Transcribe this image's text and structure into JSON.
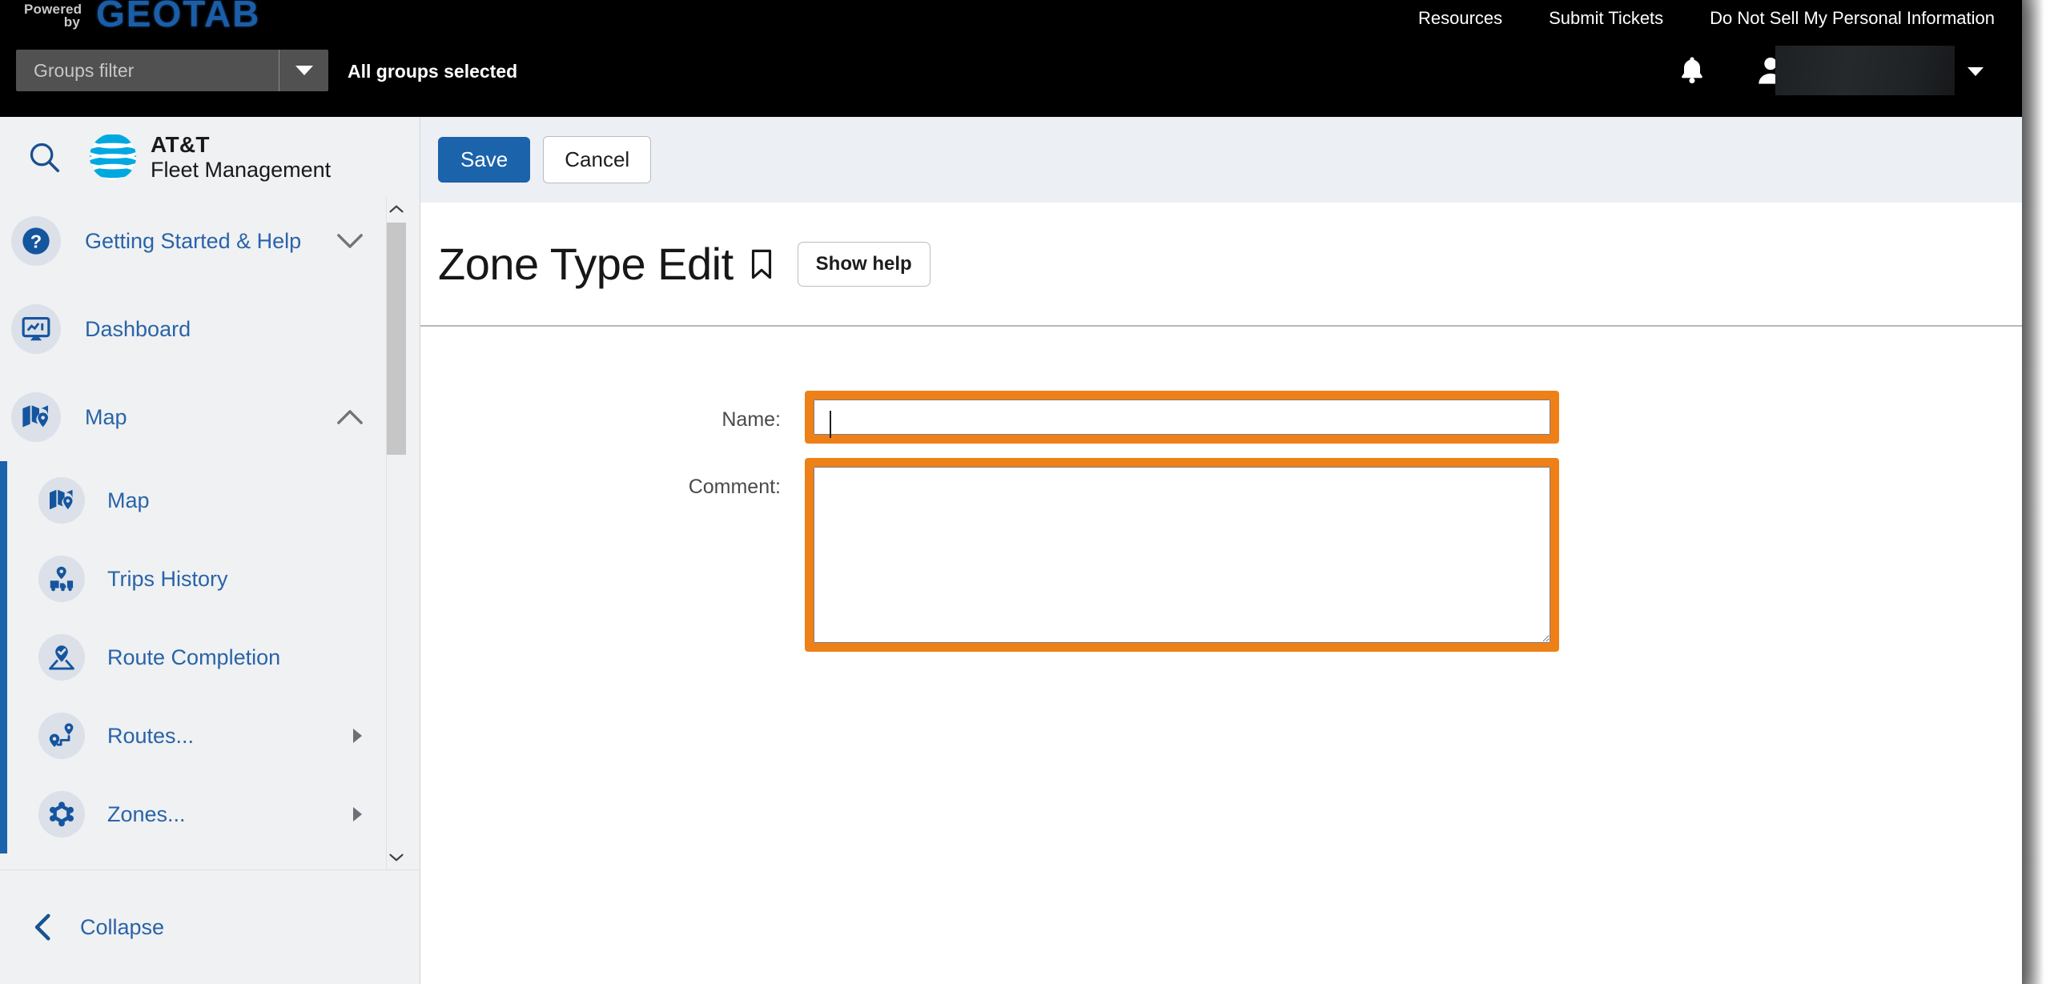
{
  "brand": {
    "powered_line1": "Powered",
    "powered_line2": "by",
    "geotab": "GEOTAB",
    "app_name_line1": "AT&T",
    "app_name_line2": "Fleet Management"
  },
  "topbar": {
    "links": [
      "Resources",
      "Submit Tickets",
      "Do Not Sell My Personal Information"
    ],
    "groups_filter_placeholder": "Groups filter",
    "groups_filter_value": "",
    "all_groups_text": "All groups selected",
    "bell_icon": "bell-icon",
    "user_icon": "user-avatar-icon",
    "user_name": "",
    "background": "#000000"
  },
  "sidebar": {
    "search_icon": "search-icon",
    "items": [
      {
        "label": "Getting Started & Help",
        "icon": "question-mark-icon",
        "chevron": "chevron-down",
        "expanded": false
      },
      {
        "label": "Dashboard",
        "icon": "dashboard-monitor-icon",
        "chevron": "",
        "expanded": false
      },
      {
        "label": "Map",
        "icon": "map-pin-icon",
        "chevron": "chevron-up",
        "expanded": true
      }
    ],
    "sub_items": [
      {
        "label": "Map",
        "icon": "map-pin-icon",
        "arrow": ""
      },
      {
        "label": "Trips History",
        "icon": "truck-pin-icon",
        "arrow": ""
      },
      {
        "label": "Route Completion",
        "icon": "route-check-icon",
        "arrow": ""
      },
      {
        "label": "Routes...",
        "icon": "routes-icon",
        "arrow": "triangle-right"
      },
      {
        "label": "Zones...",
        "icon": "zones-hex-icon",
        "arrow": "triangle-right"
      }
    ],
    "collapse_label": "Collapse",
    "collapse_icon": "chevron-left-icon",
    "scrollbar": {
      "up_icon": "chevron-up-icon",
      "down_icon": "chevron-down-icon"
    },
    "active_indicator_color": "#1b63ab",
    "accent_color": "#2a63a8"
  },
  "main": {
    "save_label": "Save",
    "cancel_label": "Cancel",
    "page_title": "Zone Type Edit",
    "bookmark_icon": "bookmark-icon",
    "show_help_label": "Show help",
    "form": {
      "name_label": "Name:",
      "name_value": "",
      "name_placeholder": "",
      "comment_label": "Comment:",
      "comment_value": "",
      "comment_placeholder": ""
    },
    "highlight_color": "#ef7f17",
    "primary_color": "#1b63ab"
  }
}
